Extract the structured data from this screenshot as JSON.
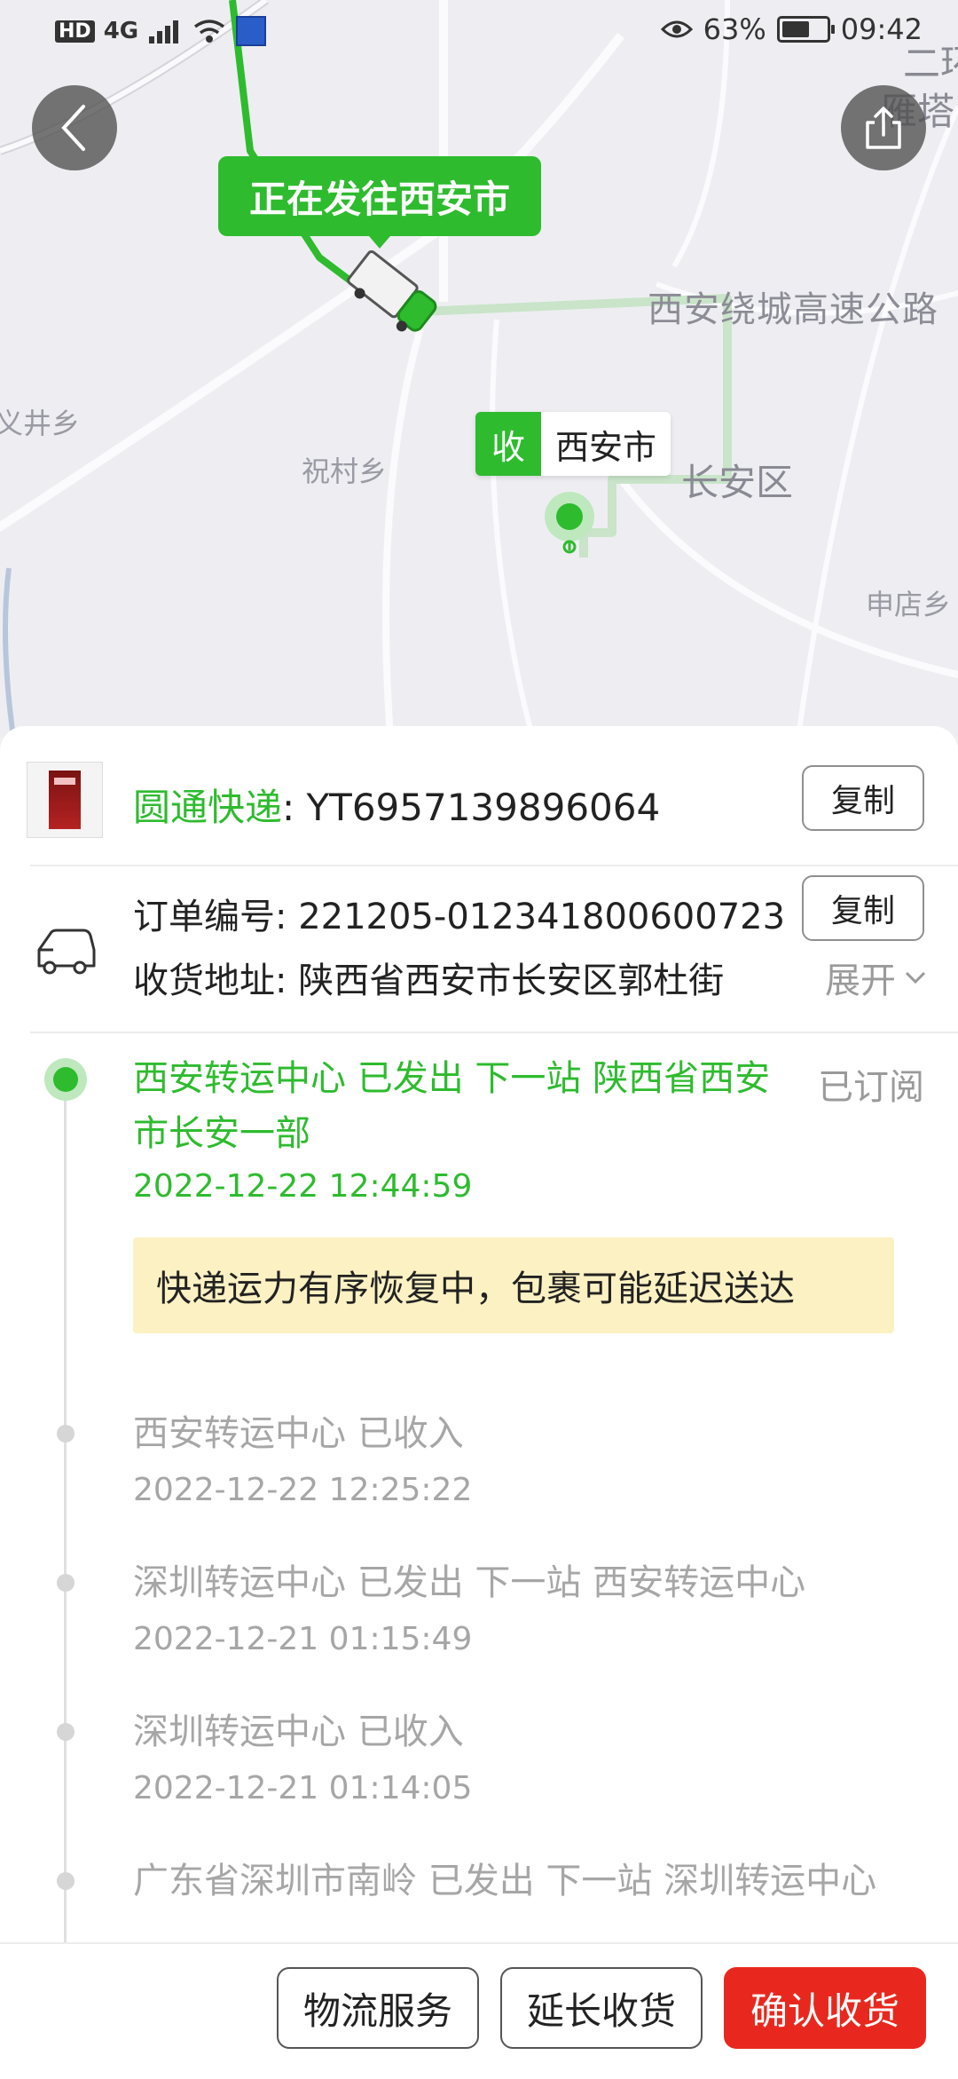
{
  "status_bar": {
    "hd": "HD",
    "network": "4G",
    "battery_percent": "63%",
    "battery_level": 0.63,
    "time": "09:42"
  },
  "map": {
    "in_transit_bubble": "正在发往西安市",
    "receiver_tag_key": "收",
    "receiver_tag_city": "西安市",
    "labels": {
      "road": "西安绕城高速公路",
      "district": "长安区",
      "town_1": "祝村乡",
      "town_2": "义井乡",
      "town_3": "申店乡",
      "corner_1": "二环",
      "corner_2": "雁塔"
    }
  },
  "package": {
    "carrier_name": "圆通快递",
    "tracking_number": ": YT6957139896064",
    "copy_label": "复制"
  },
  "order": {
    "order_no": "订单编号: 221205-012341800600723",
    "address": "收货地址: 陕西省西安市长安区郭杜街",
    "copy_label": "复制",
    "expand_label": "展开"
  },
  "timeline": {
    "subscribed_label": "已订阅",
    "notice": "快递运力有序恢复中，包裹可能延迟送达",
    "events": [
      {
        "text": "西安转运中心 已发出 下一站  陕西省西安市长安一部",
        "time": "2022-12-22 12:44:59"
      },
      {
        "text": "西安转运中心 已收入",
        "time": "2022-12-22 12:25:22"
      },
      {
        "text": "深圳转运中心 已发出 下一站  西安转运中心",
        "time": "2022-12-21 01:15:49"
      },
      {
        "text": "深圳转运中心 已收入",
        "time": "2022-12-21 01:14:05"
      },
      {
        "text": "广东省深圳市南岭 已发出 下一站  深圳转运中心",
        "time": ""
      }
    ]
  },
  "actions": {
    "logistics_service": "物流服务",
    "extend_receipt": "延长收货",
    "confirm_receipt": "确认收货"
  }
}
